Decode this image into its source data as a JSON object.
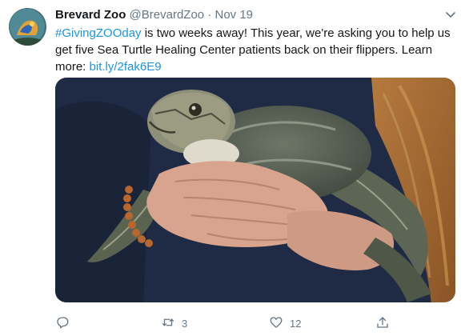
{
  "tweet": {
    "author_name": "Brevard Zoo",
    "handle": "@BrevardZoo",
    "separator": "·",
    "date": "Nov 19",
    "hashtag": "#GivingZOOday",
    "body": " is two weeks away! This year, we're asking you to help us get five Sea Turtle Healing Center patients back on their flippers. Learn more: ",
    "link": "bit.ly/2fak6E9"
  },
  "actions": {
    "reply": {
      "icon": "reply-icon",
      "count": ""
    },
    "retweet": {
      "icon": "retweet-icon",
      "count": "3"
    },
    "like": {
      "icon": "heart-icon",
      "count": "12"
    },
    "share": {
      "icon": "share-icon",
      "count": ""
    }
  },
  "colors": {
    "link": "#1b95e0",
    "secondary_text": "#657786",
    "primary_text": "#14171a"
  },
  "icons": {
    "menu": "chevron-down-icon",
    "avatar": "avatar"
  }
}
